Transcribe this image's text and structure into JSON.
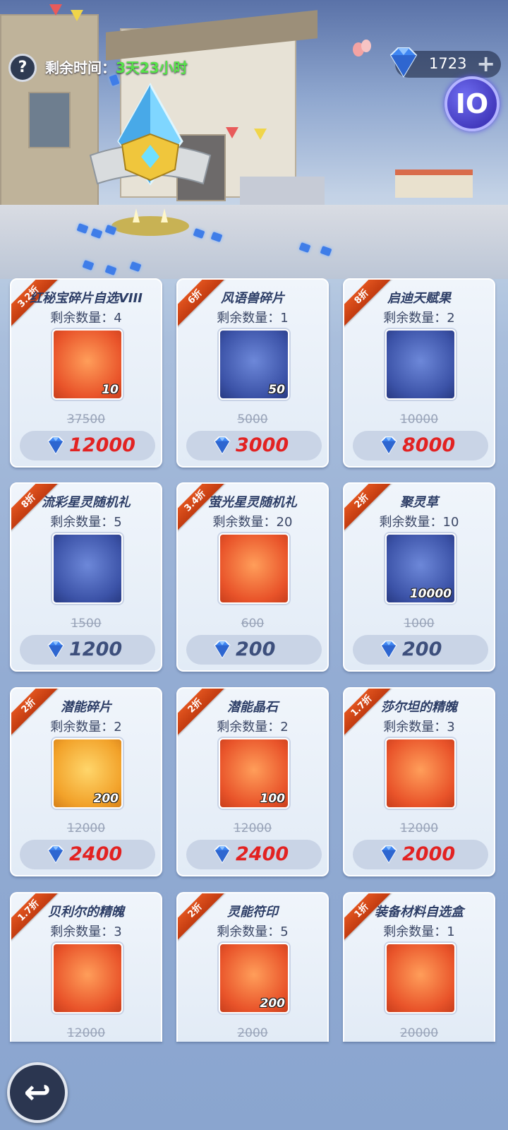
{
  "header": {
    "help_icon": "?",
    "timer_label": "剩余时间：",
    "timer_value": "3天23小时",
    "currency_amount": "1723",
    "currency_plus": "+",
    "logo_text": "IO"
  },
  "qty_label": "剩余数量：",
  "items": [
    {
      "discount": "3.2折",
      "name": "红秘宝碎片自选VIII",
      "qty": "4",
      "count": "10",
      "old": "37500",
      "price": "12000",
      "bg": "orange",
      "price_color": "red"
    },
    {
      "discount": "6折",
      "name": "风语兽碎片",
      "qty": "1",
      "count": "50",
      "old": "5000",
      "price": "3000",
      "bg": "blue",
      "price_color": "red"
    },
    {
      "discount": "8折",
      "name": "启迪天赋果",
      "qty": "2",
      "count": "",
      "old": "10000",
      "price": "8000",
      "bg": "blue",
      "price_color": "red"
    },
    {
      "discount": "8折",
      "name": "流彩星灵随机礼",
      "qty": "5",
      "count": "",
      "old": "1500",
      "price": "1200",
      "bg": "blue",
      "price_color": "blue"
    },
    {
      "discount": "3.4折",
      "name": "萤光星灵随机礼",
      "qty": "20",
      "count": "",
      "old": "600",
      "price": "200",
      "bg": "orange",
      "price_color": "blue"
    },
    {
      "discount": "2折",
      "name": "聚灵草",
      "qty": "10",
      "count": "10000",
      "old": "1000",
      "price": "200",
      "bg": "blue",
      "price_color": "blue"
    },
    {
      "discount": "2折",
      "name": "潜能碎片",
      "qty": "2",
      "count": "200",
      "old": "12000",
      "price": "2400",
      "bg": "gold",
      "price_color": "red"
    },
    {
      "discount": "2折",
      "name": "潜能晶石",
      "qty": "2",
      "count": "100",
      "old": "12000",
      "price": "2400",
      "bg": "orange",
      "price_color": "red"
    },
    {
      "discount": "1.7折",
      "name": "莎尔坦的精魄",
      "qty": "3",
      "count": "",
      "old": "12000",
      "price": "2000",
      "bg": "orange",
      "price_color": "red"
    },
    {
      "discount": "1.7折",
      "name": "贝利尔的精魄",
      "qty": "3",
      "count": "",
      "old": "12000",
      "price": "",
      "bg": "orange",
      "price_color": "red"
    },
    {
      "discount": "2折",
      "name": "灵能符印",
      "qty": "5",
      "count": "200",
      "old": "2000",
      "price": "",
      "bg": "orange",
      "price_color": "red"
    },
    {
      "discount": "1折",
      "name": "装备材料自选盒",
      "qty": "1",
      "count": "",
      "old": "20000",
      "price": "",
      "bg": "orange",
      "price_color": "red"
    }
  ],
  "icons": {
    "help": "question-icon",
    "currency": "diamond-icon",
    "back": "back-arrow-icon"
  },
  "colors": {
    "accent_red": "#e22222",
    "timer_green": "#58e34a",
    "ribbon": "#d94a18"
  }
}
